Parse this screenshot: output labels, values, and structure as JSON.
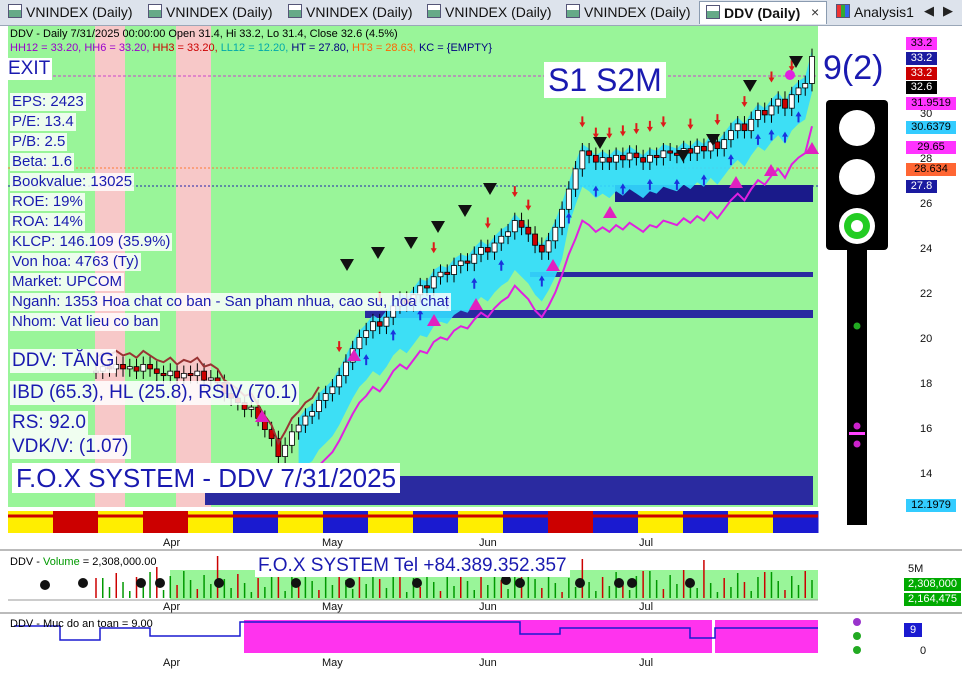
{
  "tabs": [
    {
      "label": "VNINDEX (Daily)",
      "active": false
    },
    {
      "label": "VNINDEX (Daily)",
      "active": false
    },
    {
      "label": "VNINDEX (Daily)",
      "active": false
    },
    {
      "label": "VNINDEX (Daily)",
      "active": false
    },
    {
      "label": "VNINDEX (Daily)",
      "active": false
    },
    {
      "label": "DDV (Daily)",
      "active": true
    },
    {
      "label": "Analysis1",
      "active": false
    }
  ],
  "tab_close": "×",
  "nav_left": "◀",
  "nav_right": "▶",
  "header": {
    "line1": "DDV - Daily 7/31/2025 00:00:00 Open 31.4, Hi 33.2, Lo 31.4, Close 32.6 (4.5%)",
    "line2": [
      {
        "text": "HH12 = 33.20, ",
        "color": "#9900cc"
      },
      {
        "text": "HH6 = 33.20, ",
        "color": "#9900cc"
      },
      {
        "text": "HH3 = 33.20, ",
        "color": "#cc0000"
      },
      {
        "text": "LL12 = 12.20, ",
        "color": "#00aaaa"
      },
      {
        "text": "HT = 27.80, ",
        "color": "#000080"
      },
      {
        "text": "HT3 = 28.63, ",
        "color": "#ff6600"
      },
      {
        "text": "KC = {EMPTY}",
        "color": "#000080"
      }
    ]
  },
  "overlay": {
    "exit": "EXIT",
    "fundamentals": [
      "EPS: 2423",
      "P/E: 13.4",
      "P/B: 2.5",
      "Beta: 1.6",
      "Bookvalue: 13025",
      "ROE: 19%",
      "ROA: 14%",
      "KLCP: 146.109 (35.9%)",
      "Von hoa: 4763 (Ty)",
      "Market: UPCOM",
      "Nganh: 1353 Hoa chat co ban - San pham nhua, cao su, hoa chat",
      "Nhom: Vat lieu co ban"
    ],
    "trend": "DDV: TĂNG",
    "ibd": "IBD (65.3), HL (25.8), RSIV (70.1)",
    "rs": "RS: 92.0",
    "vdk": "VDK/V:  (1.07)",
    "system": "F.O.X SYSTEM - DDV 7/31/2025",
    "signal": "S1  S2M",
    "count": "9(2)",
    "tel": "F.O.X SYSTEM Tel +84.389.352.357"
  },
  "price_axis": {
    "ticks": [
      "30",
      "28",
      "26",
      "24",
      "22",
      "20",
      "18",
      "16",
      "14"
    ],
    "boxes": [
      {
        "text": "33.2",
        "bg": "#ff33ff",
        "fg": "#000000"
      },
      {
        "text": "33.2",
        "bg": "#1a1aa0",
        "fg": "#ffffff"
      },
      {
        "text": "33.2",
        "bg": "#cc0000",
        "fg": "#ffffff"
      },
      {
        "text": "32.6",
        "bg": "#000000",
        "fg": "#ffffff"
      },
      {
        "text": "31.9519",
        "bg": "#ff33ff",
        "fg": "#000000"
      },
      {
        "text": "30.6379",
        "bg": "#33ccff",
        "fg": "#000000"
      },
      {
        "text": "29.65",
        "bg": "#ff33ff",
        "fg": "#000000"
      },
      {
        "text": "28.634",
        "bg": "#ff6633",
        "fg": "#000000"
      },
      {
        "text": "27.8",
        "bg": "#1a1aa0",
        "fg": "#ffffff"
      },
      {
        "text": "12.1979",
        "bg": "#33ccff",
        "fg": "#000000"
      }
    ]
  },
  "months": [
    "Apr",
    "May",
    "Jun",
    "Jul"
  ],
  "volume": {
    "title_prefix": "DDV - ",
    "title_label": "Volume",
    "title_value": " = 2,308,000.00",
    "axis_top": "5M",
    "box1": "2,308,000",
    "box2": "2,164,475"
  },
  "safety": {
    "title": "DDV - Muc do an toan = 9.00",
    "box": "9",
    "axis_zero": "0"
  },
  "chart_data": {
    "type": "candlestick",
    "title": "DDV - Daily 7/31/2025",
    "ylabel": "",
    "xlabel": "",
    "x_ticks": [
      "Apr",
      "May",
      "Jun",
      "Jul"
    ],
    "ylim": [
      12.2,
      33.6
    ],
    "last": {
      "date": "7/31/2025",
      "open": 31.4,
      "high": 33.2,
      "low": 31.4,
      "close": 32.6,
      "change_pct": 4.5
    },
    "levels": {
      "HH12": 33.2,
      "HH6": 33.2,
      "HH3": 33.2,
      "LL12": 12.2,
      "HT": 27.8,
      "HT3": 28.63
    },
    "close_series": [
      18.6,
      18.8,
      18.7,
      18.9,
      18.7,
      18.8,
      18.6,
      18.9,
      18.7,
      18.5,
      18.4,
      18.6,
      18.3,
      18.5,
      18.4,
      18.6,
      18.2,
      18.3,
      18.1,
      17.6,
      17.4,
      17.2,
      16.9,
      17.0,
      16.5,
      16.0,
      15.6,
      14.8,
      15.3,
      15.9,
      16.2,
      16.6,
      16.8,
      17.3,
      17.6,
      17.9,
      18.4,
      19.0,
      19.6,
      20.1,
      20.4,
      20.8,
      20.6,
      21.0,
      21.5,
      21.8,
      21.6,
      22.0,
      22.4,
      22.3,
      22.8,
      23.0,
      22.9,
      23.3,
      23.5,
      23.4,
      23.8,
      24.1,
      23.9,
      24.3,
      24.6,
      24.8,
      25.3,
      25.0,
      24.7,
      24.2,
      23.9,
      24.4,
      25.0,
      25.8,
      26.7,
      27.6,
      28.4,
      28.2,
      27.9,
      28.1,
      27.9,
      28.2,
      28.0,
      28.3,
      28.1,
      27.9,
      28.2,
      28.1,
      28.4,
      28.3,
      28.2,
      28.5,
      28.3,
      28.6,
      28.4,
      28.8,
      28.5,
      28.9,
      29.3,
      29.6,
      29.3,
      29.8,
      30.2,
      30.0,
      30.4,
      30.7,
      30.3,
      30.9,
      31.2,
      31.4,
      32.6
    ]
  }
}
